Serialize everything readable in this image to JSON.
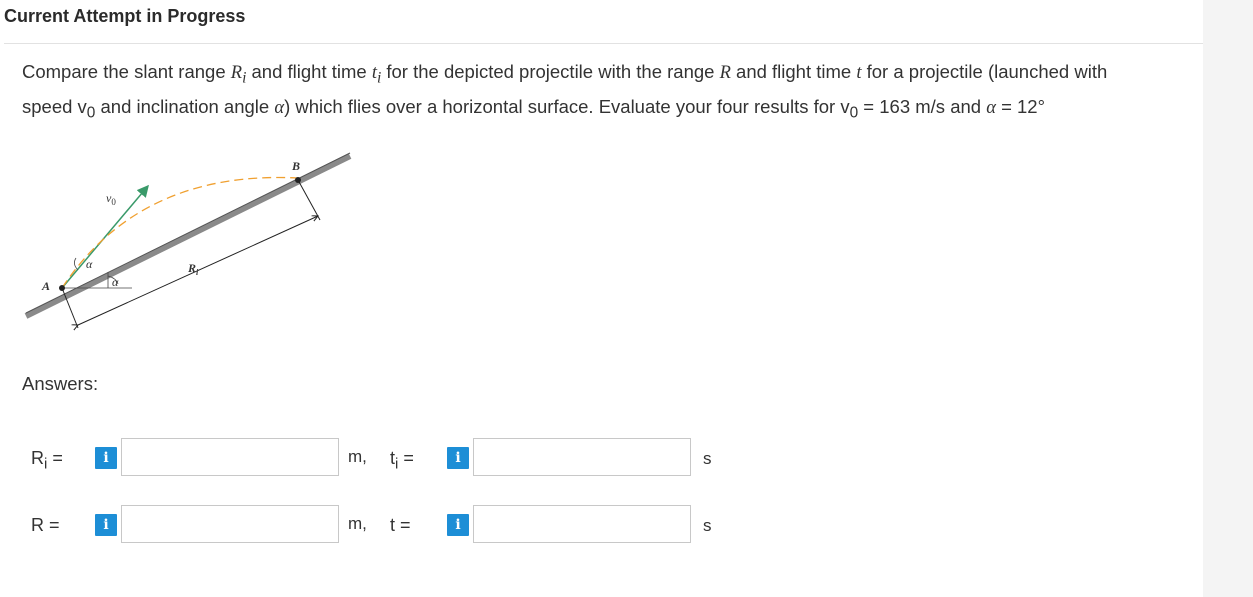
{
  "header": {
    "title": "Current Attempt in Progress"
  },
  "question": {
    "line1_pre": "Compare the slant range ",
    "Ri": "R",
    "Ri_sub": "i",
    "mid1": " and flight time ",
    "ti": "t",
    "ti_sub": "i",
    "mid2": " for the depicted projectile with the range ",
    "R": "R",
    "mid3": " and flight time ",
    "t": "t",
    "line1_post": " for a projectile (launched with",
    "line2_pre": "speed ",
    "v0": "v",
    "v0_sub": "0",
    "line2_mid": " and inclination angle ",
    "alpha": "α",
    "line2_mid2": ") which flies over a horizontal surface. Evaluate your four results for ",
    "v0b": "v",
    "v0b_sub": "0",
    "line2_val": " = 163 m/s and ",
    "alphab": "α",
    "line2_end": " = 12°"
  },
  "figure": {
    "point_A": "A",
    "point_B": "B",
    "v0_label": "v",
    "v0_sub": "0",
    "alpha_upper": "α",
    "alpha_lower": "α",
    "Ri_label": "R",
    "Ri_sub": "i"
  },
  "answers": {
    "label": "Answers:",
    "rows": [
      {
        "left_label": "R",
        "left_sub": "i",
        "left_eq": " =",
        "left_unit": "m,",
        "right_label": "t",
        "right_sub": "i",
        "right_eq": " =",
        "right_unit": "s",
        "left_value": "",
        "right_value": ""
      },
      {
        "left_label": "R",
        "left_sub": "",
        "left_eq": " =",
        "left_unit": "m,",
        "right_label": "t",
        "right_sub": "",
        "right_eq": " =",
        "right_unit": "s",
        "left_value": "",
        "right_value": ""
      }
    ],
    "info_glyph": "i"
  },
  "colors": {
    "info_button": "#1d8ed6",
    "trajectory": "#f0a030",
    "velocity": "#3a9a6a"
  }
}
